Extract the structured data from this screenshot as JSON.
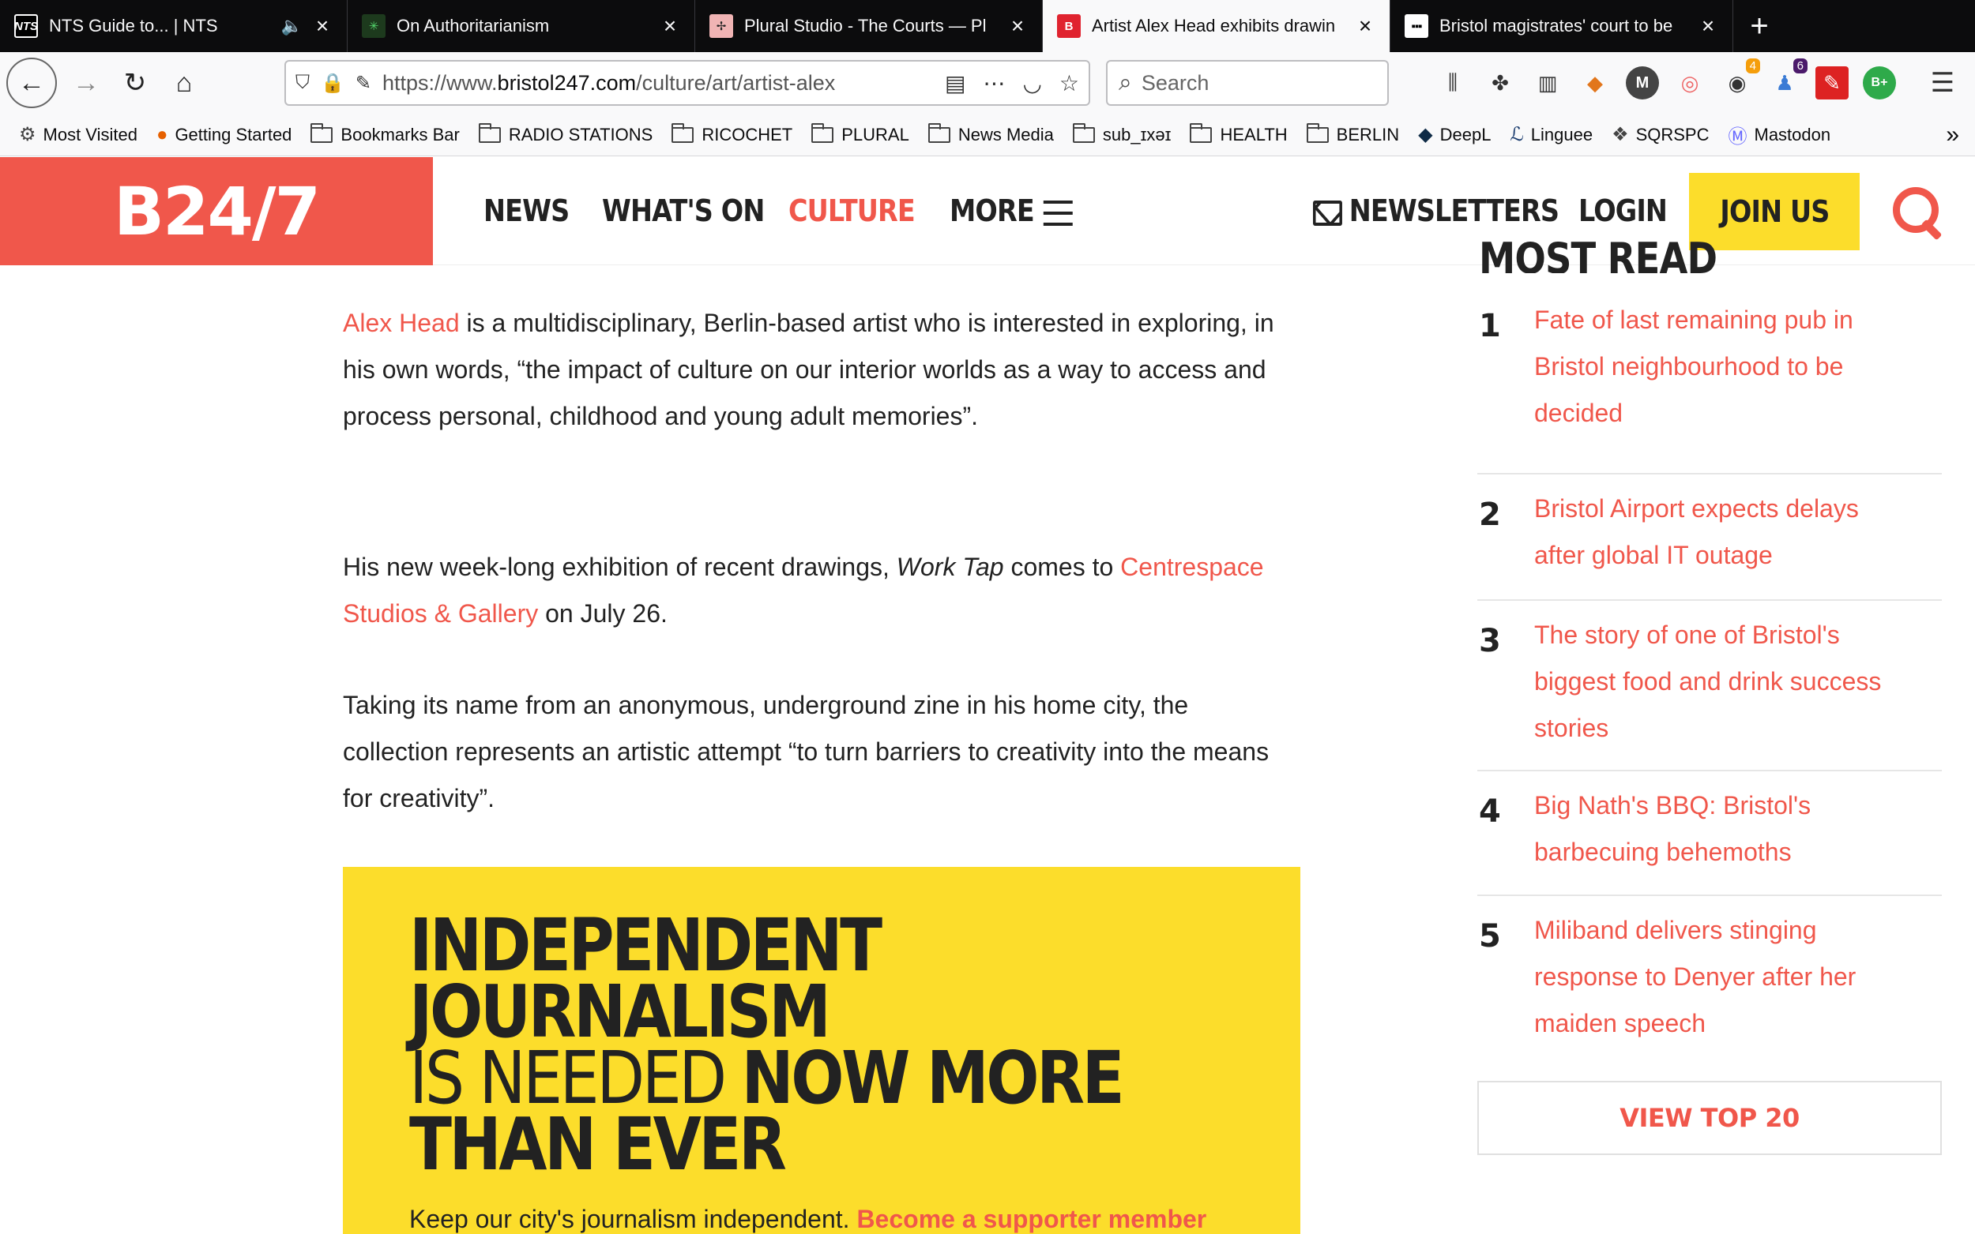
{
  "browser": {
    "tabs": [
      {
        "title": "NTS Guide to... | NTS",
        "favicon": "NTS"
      },
      {
        "title": "On Authoritarianism",
        "favicon": "✳"
      },
      {
        "title": "Plural Studio - The Courts — Pl",
        "favicon": "✢"
      },
      {
        "title": "Artist Alex Head exhibits drawin",
        "favicon": "B"
      },
      {
        "title": "Bristol magistrates' court to be",
        "favicon": "▪▪▪"
      }
    ],
    "url_prefix": "https://www.",
    "url_domain": "bristol247.com",
    "url_path": "/culture/art/artist-alex",
    "search_placeholder": "Search",
    "toolbar_badges": {
      "extension_a": "4",
      "extension_b": "6"
    },
    "bookmarks": [
      "Most Visited",
      "Getting Started",
      "Bookmarks Bar",
      "RADIO STATIONS",
      "RICOCHET",
      "PLURAL",
      "News Media",
      "sub_ɪxəɪ",
      "HEALTH",
      "BERLIN",
      "DeepL",
      "Linguee",
      "SQRSPC",
      "Mastodon"
    ]
  },
  "site": {
    "logo": "B24/7",
    "nav": {
      "news": "NEWS",
      "whats_on": "WHAT'S ON",
      "culture": "CULTURE",
      "more": "MORE",
      "newsletters": "NEWSLETTERS",
      "login": "LOGIN",
      "join": "JOIN US"
    },
    "accent_color": "#f0574b",
    "yellow_color": "#fcdd2b"
  },
  "article": {
    "p1_link": "Alex Head",
    "p1_text": " is a multidisciplinary, Berlin-based artist who is interested in exploring, in his own words, “the impact of culture on our interior worlds as a way to access and process personal, childhood and young adult memories”.",
    "p2_a": "His new week-long exhibition of recent drawings, ",
    "p2_em": "Work Tap",
    "p2_b": " comes to ",
    "p2_link": "Centrespace Studios & Gallery",
    "p2_c": " on July 26.",
    "p3": "Taking its name from an anonymous, underground zine in his home city, the collection represents an artistic attempt “to turn barriers to creativity into the means for creativity”."
  },
  "promo": {
    "line1": "INDEPENDENT",
    "line2": "JOURNALISM",
    "line3_light": "IS NEEDED ",
    "line3_bold": "NOW MORE",
    "line4": "THAN EVER",
    "sub_text": "Keep our city's journalism independent. ",
    "sub_link": "Become a supporter member"
  },
  "sidebar": {
    "title": "MOST READ",
    "items": [
      {
        "num": "1",
        "title": "Fate of last remaining pub in Bristol neighbourhood to be decided"
      },
      {
        "num": "2",
        "title": "Bristol Airport expects delays after global IT outage"
      },
      {
        "num": "3",
        "title": "The story of one of Bristol's biggest food and drink success stories"
      },
      {
        "num": "4",
        "title": "Big Nath's BBQ: Bristol's barbecuing behemoths"
      },
      {
        "num": "5",
        "title": "Miliband delivers stinging response to Denyer after her maiden speech"
      }
    ],
    "view_all": "VIEW TOP 20"
  }
}
